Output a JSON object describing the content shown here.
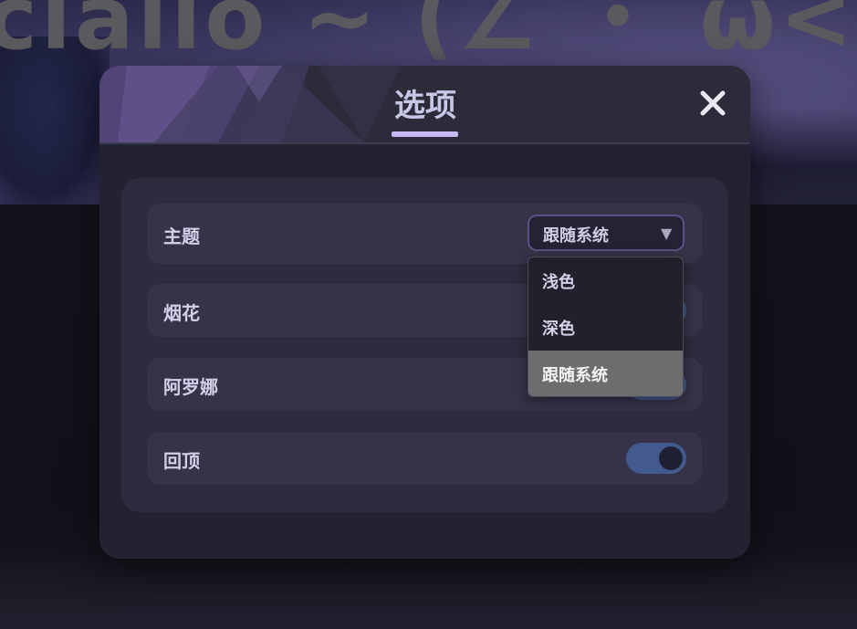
{
  "background": {
    "kaomoji": "ciallo ~ (∠ ・ ω< )⌒"
  },
  "dialog": {
    "title": "选项",
    "close_icon": "close-icon",
    "accent_color": "#c7b9f2"
  },
  "settings": [
    {
      "label": "主题",
      "control": "select",
      "value": "跟随系统"
    },
    {
      "label": "烟花",
      "control": "toggle",
      "on": true
    },
    {
      "label": "阿罗娜",
      "control": "toggle",
      "on": true
    },
    {
      "label": "回顶",
      "control": "toggle",
      "on": true
    }
  ],
  "theme_select": {
    "value": "跟随系统",
    "arrow_icon": "triangle-down-icon",
    "options": [
      "浅色",
      "深色",
      "跟随系统"
    ],
    "selected_index": 2
  },
  "colors": {
    "toggle_on": "#425a8e",
    "selected_option": "#6d6d6f"
  }
}
